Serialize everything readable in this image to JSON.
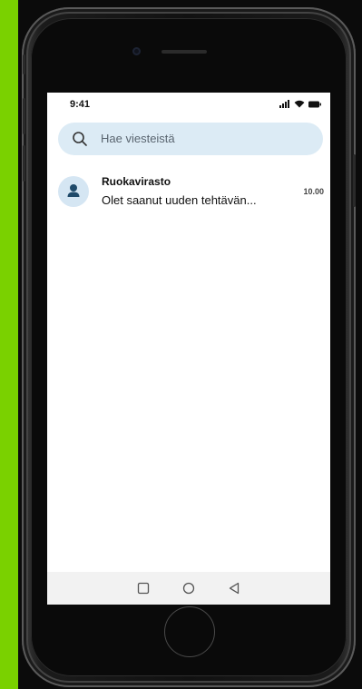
{
  "status_bar": {
    "time": "9:41"
  },
  "search": {
    "placeholder": "Hae viesteistä"
  },
  "messages": [
    {
      "sender": "Ruokavirasto",
      "preview": "Olet saanut uuden tehtävän...",
      "time": "10.00"
    }
  ],
  "icons": {
    "search": "search-icon",
    "avatar": "person-icon",
    "nav": [
      "square-icon",
      "circle-icon",
      "triangle-back-icon"
    ]
  },
  "colors": {
    "left_strip": "#7ad100",
    "search_bg": "#dcebf5",
    "avatar_bg": "#d5e6f3",
    "avatar_icon": "#1f4a6a"
  }
}
